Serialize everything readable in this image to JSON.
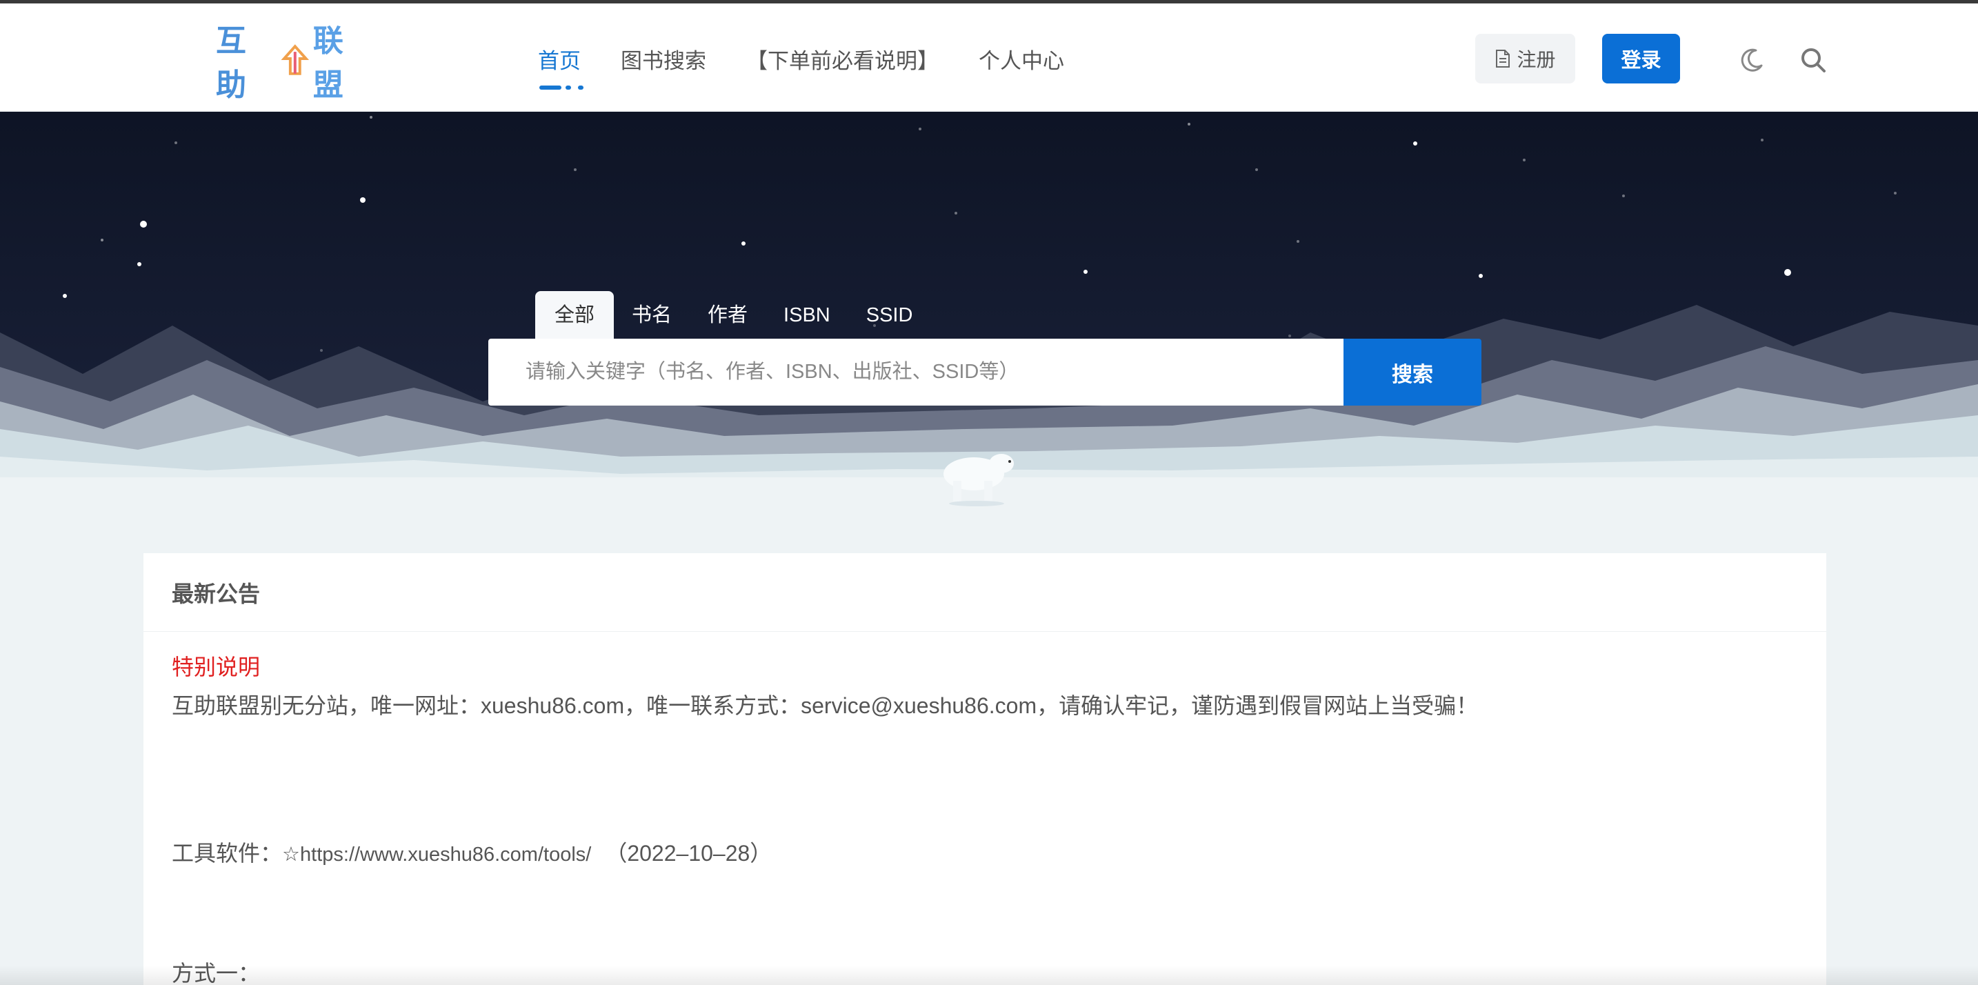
{
  "brand": {
    "logo_left": "互助",
    "logo_right": "联盟"
  },
  "nav": {
    "items": [
      {
        "label": "首页",
        "active": true
      },
      {
        "label": "图书搜索",
        "active": false
      },
      {
        "label": "【下单前必看说明】",
        "active": false
      },
      {
        "label": "个人中心",
        "active": false
      }
    ],
    "register_label": "注册",
    "login_label": "登录"
  },
  "search": {
    "tabs": [
      "全部",
      "书名",
      "作者",
      "ISBN",
      "SSID"
    ],
    "active_tab": "全部",
    "placeholder": "请输入关键字（书名、作者、ISBN、出版社、SSID等）",
    "button_label": "搜索"
  },
  "announcement": {
    "title": "最新公告",
    "special_title": "特别说明",
    "notice": "互助联盟别无分站，唯一网址：xueshu86.com，唯一联系方式：service@xueshu86.com，请确认牢记，谨防遇到假冒网站上当受骗！",
    "tools_label": "工具软件：",
    "tools_link": "☆https://www.xueshu86.com/tools/",
    "tools_date": "（2022–10–28）",
    "method_label": "方式一："
  },
  "colors": {
    "accent": "#0b6fd6",
    "special": "#e02020",
    "hero_dark": "#0e1425"
  },
  "icons": [
    "document-icon",
    "moon-icon",
    "search-icon",
    "polar-bear-illustration"
  ]
}
